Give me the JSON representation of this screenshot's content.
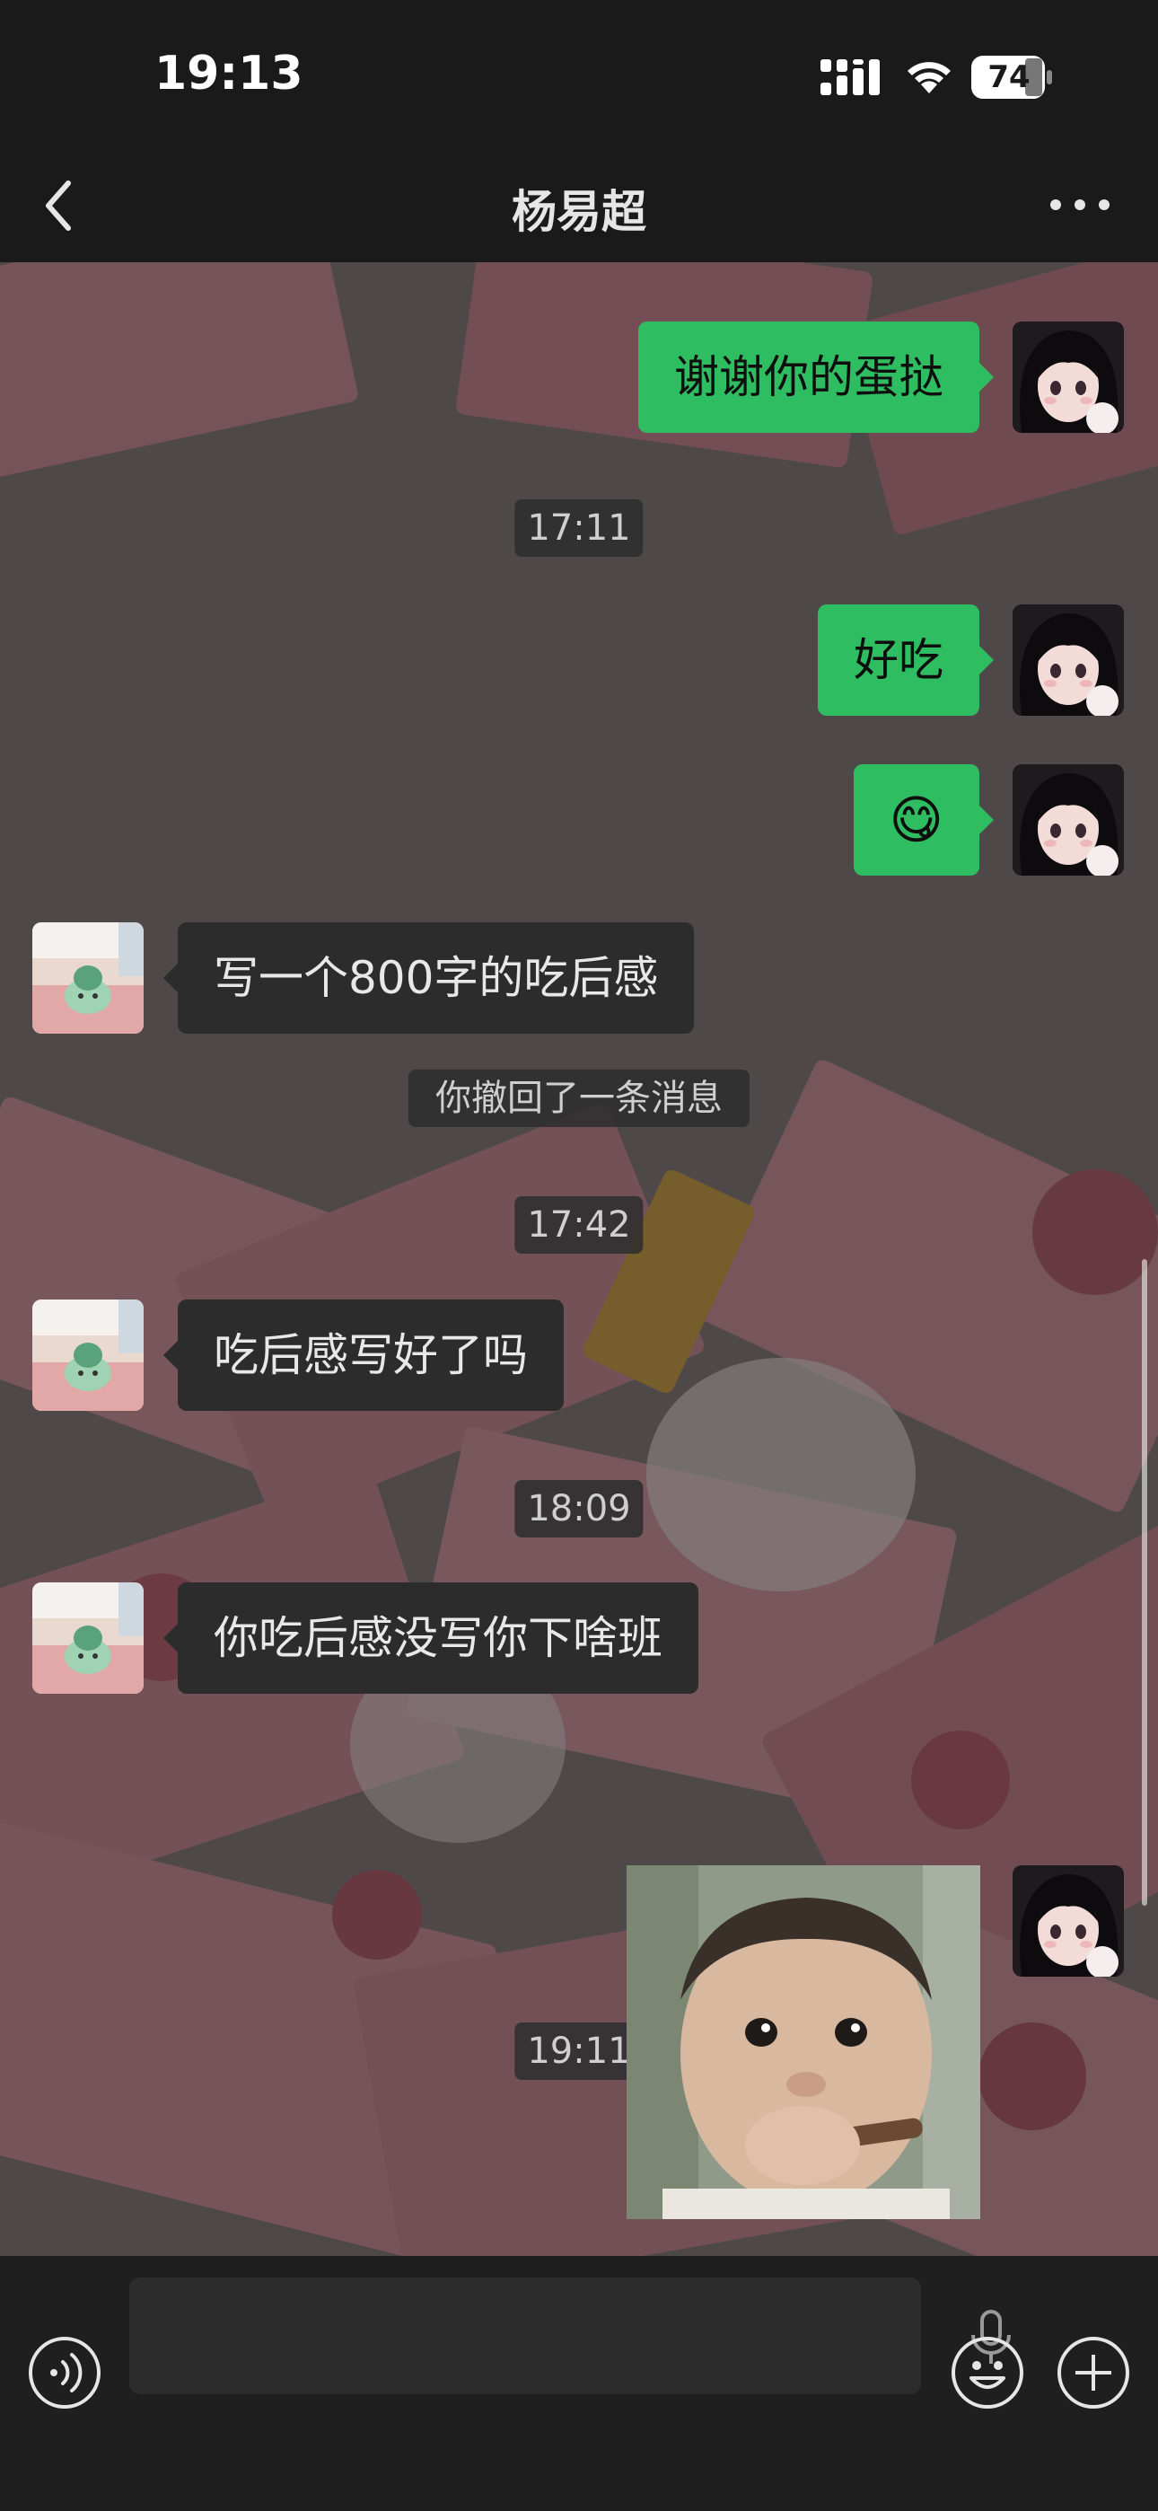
{
  "status_bar": {
    "time": "19:13",
    "battery_level": "74",
    "icons": [
      "signal-icon",
      "wifi-icon",
      "battery-icon"
    ]
  },
  "nav": {
    "title": "杨易超",
    "back_icon": "chevron-left-icon",
    "more_icon": "ellipsis-icon"
  },
  "messages": [
    {
      "type": "text",
      "direction": "out",
      "text": "谢谢你的蛋挞"
    },
    {
      "type": "time",
      "text": "17:11"
    },
    {
      "type": "text",
      "direction": "out",
      "text": "好吃"
    },
    {
      "type": "emoji",
      "direction": "out",
      "text": "😋"
    },
    {
      "type": "text",
      "direction": "in",
      "text": "写一个800字的吃后感"
    },
    {
      "type": "system",
      "text": "你撤回了一条消息"
    },
    {
      "type": "time",
      "text": "17:42"
    },
    {
      "type": "text",
      "direction": "in",
      "text": "吃后感写好了吗"
    },
    {
      "type": "time",
      "text": "18:09"
    },
    {
      "type": "text",
      "direction": "in",
      "text": "你吃后感没写你下啥班"
    },
    {
      "type": "time",
      "text": "19:11"
    },
    {
      "type": "image",
      "direction": "out",
      "content": "photo of a baby holding a cigar"
    }
  ],
  "input_bar": {
    "voice_icon": "voice-toggle-icon",
    "mic_icon": "microphone-icon",
    "emoji_icon": "smiley-icon",
    "add_icon": "plus-circle-icon"
  },
  "colors": {
    "outgoing_bubble": "#2ebe61",
    "incoming_bubble": "#2c2c2c",
    "header_background": "#1a1a1a"
  }
}
